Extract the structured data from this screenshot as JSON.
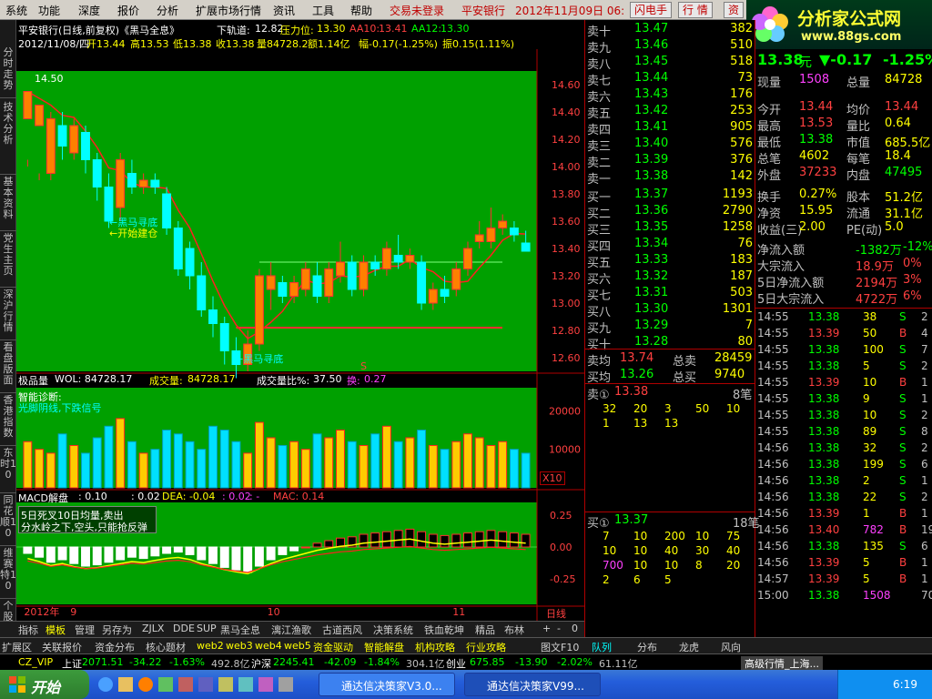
{
  "menu": {
    "items": [
      "系统",
      "功能",
      "深度",
      "报价",
      "分析",
      "扩展市场行情",
      "资讯",
      "工具",
      "帮助"
    ],
    "status": "交易未登录",
    "stock": "平安银行",
    "datetime": "2012年11月09日 06:",
    "buttons": [
      "闪电手",
      "行 情",
      "资"
    ]
  },
  "logo": {
    "title": "分析家公式网",
    "url": "www.88gs.com"
  },
  "left_tabs": [
    "分时走势",
    "技术分析",
    "基本资料",
    "党生主页",
    "深沪行情",
    "看盘版面",
    "香港指数",
    "东时10",
    "同花顺10",
    "维赛特10",
    "个股龙虎"
  ],
  "chart_header": {
    "line1": "平安银行(日线,前复权)《黑马全息》",
    "track_label": "下轨道:",
    "track_value": "12.82",
    "pressure_label": "压力位:",
    "pressure_value": "13.30",
    "aa10_label": "AA10:",
    "aa10_value": "13.41",
    "aa12_label": "AA12:",
    "aa12_value": "13.30",
    "line2": "2012/11/08/四",
    "open": "开13.44",
    "high": "高13.53",
    "low": "低13.38",
    "close": "收13.38",
    "vol": "量84728.2",
    "amount": "额1.14亿",
    "change": "幅-0.17(-1.25%)",
    "swing": "振0.15(1.11%)"
  },
  "price_annotations": {
    "start_level": "14.50",
    "dark_horse_bottom": "←黑马寻底",
    "start_build": "←开始建仓",
    "dark_horse_bottom2": "←黑马寻底",
    "s_marker": "S"
  },
  "volume_header": {
    "label": "极品量",
    "wol": "WOL: 84728.17",
    "cj_label": "成交量:",
    "cj_value": "84728.17",
    "ratio_label": "成交量比%:",
    "ratio_value": "37.50",
    "huan_label": "换:",
    "huan_value": "0.27",
    "diag_title": "智能诊断:",
    "diag_text": "光脚阴线,下跌信号",
    "x10": "X10"
  },
  "macd_header": {
    "label": "MACD解盘",
    "v1": ": 0.10",
    "v2": ": 0.02",
    "dea": "DEA: -0.04",
    "v3": ": 0.02",
    "v4": ": -",
    "macd": "MAC: 0.14",
    "note1": "5日死叉10日均量,卖出",
    "note2": "分水岭之下,空头,只能抢反弹"
  },
  "chart_data": {
    "type": "candlestick",
    "candles": [
      [
        14.35,
        14.55,
        14.05,
        14.0
      ],
      [
        14.3,
        14.45,
        13.95,
        13.9
      ],
      [
        13.95,
        14.35,
        14.4,
        13.9
      ],
      [
        14.3,
        14.15,
        14.4,
        14.05
      ],
      [
        14.1,
        14.3,
        14.35,
        14.05
      ],
      [
        14.25,
        14.05,
        14.3,
        13.95
      ],
      [
        14.05,
        13.85,
        14.1,
        13.75
      ],
      [
        13.85,
        13.6,
        13.95,
        13.55
      ],
      [
        13.7,
        14.05,
        14.1,
        13.6
      ],
      [
        13.95,
        13.85,
        14.05,
        13.8
      ],
      [
        13.85,
        13.9,
        13.95,
        13.8
      ],
      [
        13.9,
        13.85,
        13.95,
        13.8
      ],
      [
        13.8,
        13.55,
        13.85,
        13.5
      ],
      [
        13.55,
        13.25,
        13.6,
        13.2
      ],
      [
        13.4,
        13.2,
        13.45,
        13.1
      ],
      [
        13.2,
        12.95,
        13.3,
        12.9
      ],
      [
        12.95,
        12.85,
        13.05,
        12.75
      ],
      [
        12.85,
        12.65,
        12.9,
        12.55
      ],
      [
        12.65,
        12.55,
        12.75,
        12.45
      ],
      [
        12.55,
        12.7,
        12.8,
        12.5
      ],
      [
        12.7,
        13.2,
        13.25,
        12.65
      ],
      [
        13.1,
        13.2,
        13.3,
        12.95
      ],
      [
        13.15,
        13.05,
        13.2,
        13.0
      ],
      [
        13.05,
        13.15,
        13.2,
        13.0
      ],
      [
        13.1,
        13.25,
        13.3,
        13.05
      ],
      [
        13.2,
        13.05,
        13.3,
        13.0
      ],
      [
        13.05,
        13.25,
        13.3,
        13.0
      ],
      [
        13.2,
        13.3,
        13.45,
        13.15
      ],
      [
        13.3,
        13.1,
        13.35,
        13.05
      ],
      [
        13.1,
        13.3,
        13.35,
        13.05
      ],
      [
        13.3,
        13.25,
        13.35,
        13.2
      ],
      [
        13.25,
        13.4,
        13.45,
        13.2
      ],
      [
        13.35,
        13.3,
        13.5,
        13.25
      ],
      [
        13.3,
        13.35,
        13.4,
        13.25
      ],
      [
        13.3,
        13.0,
        13.35,
        12.95
      ],
      [
        13.0,
        13.1,
        13.15,
        12.95
      ],
      [
        13.1,
        13.05,
        13.2,
        13.0
      ],
      [
        13.1,
        13.25,
        13.3,
        13.05
      ],
      [
        13.25,
        13.4,
        13.45,
        13.2
      ],
      [
        13.45,
        13.5,
        13.6,
        13.4
      ],
      [
        13.45,
        13.55,
        13.7,
        13.4
      ],
      [
        13.55,
        13.6,
        13.65,
        13.5
      ],
      [
        13.55,
        13.5,
        13.6,
        13.45
      ],
      [
        13.44,
        13.38,
        13.53,
        13.38
      ]
    ],
    "price_axis": [
      14.6,
      14.4,
      14.2,
      14.0,
      13.8,
      13.6,
      13.4,
      13.2,
      13.0,
      12.8,
      12.6
    ],
    "price_range": [
      12.5,
      14.7
    ],
    "support_line": 12.82,
    "pressure_line": 13.3,
    "volume_axis": [
      20000,
      10000
    ],
    "volume_range": [
      0,
      26000
    ],
    "volume_values": [
      12000,
      10000,
      9000,
      14000,
      11000,
      9000,
      13000,
      16000,
      18000,
      12000,
      9000,
      10000,
      15000,
      14000,
      12000,
      10000,
      16000,
      15000,
      12000,
      9000,
      17000,
      13000,
      11000,
      12000,
      10000,
      14000,
      13000,
      15000,
      12000,
      11000,
      14000,
      16000,
      12000,
      13000,
      15000,
      11000,
      10000,
      12000,
      14000,
      13000,
      11000,
      12000,
      10000,
      9000
    ],
    "macd_axis": [
      0.25,
      0.0,
      -0.25
    ],
    "macd_range": [
      -0.45,
      0.35
    ],
    "macd_values": [
      -0.05,
      -0.08,
      -0.12,
      -0.1,
      -0.13,
      -0.15,
      -0.14,
      -0.12,
      -0.1,
      -0.08,
      -0.09,
      -0.07,
      -0.05,
      -0.04,
      -0.06,
      -0.1,
      -0.13,
      -0.16,
      -0.18,
      -0.2,
      -0.15,
      -0.1,
      -0.06,
      -0.03,
      0.0,
      0.03,
      0.05,
      0.07,
      0.08,
      0.1,
      0.11,
      0.12,
      0.13,
      0.14,
      0.12,
      0.1,
      0.09,
      0.1,
      0.11,
      0.12,
      0.13,
      0.12,
      0.11,
      0.1
    ],
    "x_labels": [
      "2012年",
      "9",
      "10",
      "11"
    ],
    "x_label_indices": [
      0,
      4,
      21,
      37
    ],
    "period": "日线"
  },
  "quote": {
    "sell": [
      {
        "label": "卖十",
        "price": "13.47",
        "vol": "382"
      },
      {
        "label": "卖九",
        "price": "13.46",
        "vol": "510"
      },
      {
        "label": "卖八",
        "price": "13.45",
        "vol": "518"
      },
      {
        "label": "卖七",
        "price": "13.44",
        "vol": "73"
      },
      {
        "label": "卖六",
        "price": "13.43",
        "vol": "176"
      },
      {
        "label": "卖五",
        "price": "13.42",
        "vol": "253"
      },
      {
        "label": "卖四",
        "price": "13.41",
        "vol": "905"
      },
      {
        "label": "卖三",
        "price": "13.40",
        "vol": "576"
      },
      {
        "label": "卖二",
        "price": "13.39",
        "vol": "376"
      },
      {
        "label": "卖一",
        "price": "13.38",
        "vol": "142"
      }
    ],
    "buy": [
      {
        "label": "买一",
        "price": "13.37",
        "vol": "1193"
      },
      {
        "label": "买二",
        "price": "13.36",
        "vol": "2790"
      },
      {
        "label": "买三",
        "price": "13.35",
        "vol": "1258"
      },
      {
        "label": "买四",
        "price": "13.34",
        "vol": "76"
      },
      {
        "label": "买五",
        "price": "13.33",
        "vol": "183"
      },
      {
        "label": "买六",
        "price": "13.32",
        "vol": "187"
      },
      {
        "label": "买七",
        "price": "13.31",
        "vol": "503"
      },
      {
        "label": "买八",
        "price": "13.30",
        "vol": "1301"
      },
      {
        "label": "买九",
        "price": "13.29",
        "vol": "7"
      },
      {
        "label": "买十",
        "price": "13.28",
        "vol": "80"
      }
    ],
    "avg_sell_label": "卖均",
    "avg_sell": "13.74",
    "total_sell_label": "总卖",
    "total_sell": "28459",
    "avg_buy_label": "买均",
    "avg_buy": "13.26",
    "total_buy_label": "总买",
    "total_buy": "9740",
    "sell_queue_label": "卖①",
    "sell_queue_price": "13.38",
    "sell_queue_count": "8笔",
    "sell_queue": [
      [
        "32",
        "20",
        "3",
        "50",
        "10"
      ],
      [
        "1",
        "13",
        "13"
      ]
    ],
    "buy_queue_label": "买①",
    "buy_queue_price": "13.37",
    "buy_queue_count": "18笔",
    "buy_queue": [
      [
        "7",
        "10",
        "200",
        "10",
        "75"
      ],
      [
        "10",
        "10",
        "40",
        "30",
        "40"
      ],
      [
        "700",
        "10",
        "10",
        "8",
        "20"
      ],
      [
        "2",
        "6",
        "5"
      ]
    ]
  },
  "stats": {
    "price": "13.38",
    "unit": "元",
    "change": "▼-0.17",
    "pct": "-1.25%",
    "rows": [
      [
        "现量",
        "1508",
        "总量",
        "84728"
      ],
      [
        "今开",
        "13.44",
        "均价",
        "13.44"
      ],
      [
        "最高",
        "13.53",
        "量比",
        "0.64"
      ],
      [
        "最低",
        "13.38",
        "市值",
        "685.5亿"
      ],
      [
        "总笔",
        "4602",
        "每笔",
        "18.4"
      ],
      [
        "外盘",
        "37233",
        "内盘",
        "47495"
      ],
      [
        "换手",
        "0.27%",
        "股本",
        "51.2亿"
      ],
      [
        "净资",
        "15.95",
        "流通",
        "31.1亿"
      ],
      [
        "收益(三)",
        "2.00",
        "PE(动)",
        "5.0"
      ]
    ],
    "flow": [
      [
        "净流入额",
        "-1382万",
        "-12%"
      ],
      [
        "大宗流入",
        "18.9万",
        "0%"
      ],
      [
        "5日净流入额",
        "2194万",
        "3%"
      ],
      [
        "5日大宗流入",
        "4722万",
        "6%"
      ]
    ]
  },
  "ticks": [
    [
      "14:55",
      "13.38",
      "38",
      "S",
      "2"
    ],
    [
      "14:55",
      "13.39",
      "50",
      "B",
      "4"
    ],
    [
      "14:55",
      "13.38",
      "100",
      "S",
      "7"
    ],
    [
      "14:55",
      "13.38",
      "5",
      "S",
      "2"
    ],
    [
      "14:55",
      "13.39",
      "10",
      "B",
      "1"
    ],
    [
      "14:55",
      "13.38",
      "9",
      "S",
      "1"
    ],
    [
      "14:55",
      "13.38",
      "10",
      "S",
      "2"
    ],
    [
      "14:55",
      "13.38",
      "89",
      "S",
      "8"
    ],
    [
      "14:56",
      "13.38",
      "32",
      "S",
      "2"
    ],
    [
      "14:56",
      "13.38",
      "199",
      "S",
      "6"
    ],
    [
      "14:56",
      "13.38",
      "2",
      "S",
      "1"
    ],
    [
      "14:56",
      "13.38",
      "22",
      "S",
      "2"
    ],
    [
      "14:56",
      "13.39",
      "1",
      "B",
      "1"
    ],
    [
      "14:56",
      "13.40",
      "782",
      "B",
      "19"
    ],
    [
      "14:56",
      "13.38",
      "135",
      "S",
      "6"
    ],
    [
      "14:56",
      "13.39",
      "5",
      "B",
      "1"
    ],
    [
      "14:57",
      "13.39",
      "5",
      "B",
      "1"
    ],
    [
      "15:00",
      "13.38",
      "1508",
      "",
      "70"
    ]
  ],
  "right_tabs": [
    "笔",
    "价",
    "细",
    "盘",
    "势",
    "指",
    "值",
    "筹"
  ],
  "bottom_tabs": [
    "指标",
    "模板",
    "管理",
    "另存为",
    "ZJLX",
    "DDE",
    "SUP",
    "黑马全息",
    "漓江渔歌",
    "古道西风",
    "决策系统",
    "铁血乾坤",
    "精品",
    "布林"
  ],
  "bottom_right": [
    "+",
    "-",
    "0"
  ],
  "ext_tabs": [
    "扩展区",
    "关联报价",
    "资金分布",
    "核心题材",
    "web2",
    "web3",
    "web4",
    "web5",
    "资金驱动",
    "智能解盘",
    "机构攻略",
    "行业攻略"
  ],
  "ext_right_tabs": [
    "图文F10",
    "队列",
    "分布",
    "龙虎",
    "风向"
  ],
  "index_bar": {
    "cz": "CZ_VIP",
    "sh_label": "上证",
    "sh": "2071.51",
    "sh_chg": "-34.22",
    "sh_pct": "-1.63%",
    "sh_amt": "492.8亿",
    "sz_label": "沪深",
    "sz": "2245.41",
    "sz_chg": "-42.09",
    "sz_pct": "-1.84%",
    "sz_amt": "304.1亿",
    "cy_label": "创业",
    "cy": "675.85",
    "cy_chg": "-13.90",
    "cy_pct": "-2.02%",
    "cy_amt": "61.11亿",
    "right": "高级行情_上海..."
  },
  "taskbar": {
    "start": "开始",
    "tasks": [
      "通达信决策家V3.0...",
      "通达信决策家V99..."
    ],
    "clock": "6:19"
  }
}
